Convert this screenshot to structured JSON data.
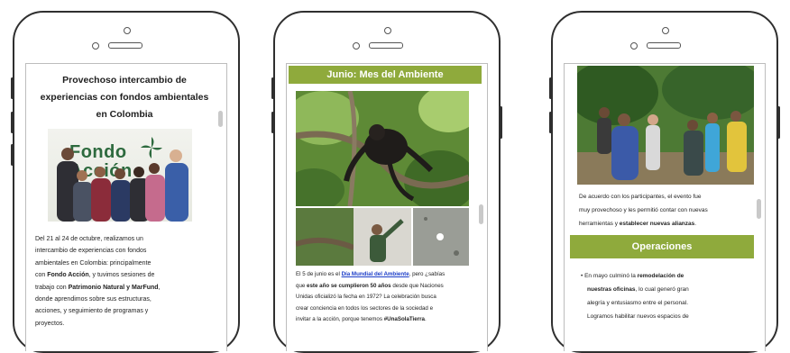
{
  "phone1": {
    "title": [
      "Provechoso intercambio de",
      "experiencias con fondos ambientales",
      "en Colombia"
    ],
    "logo_text": [
      "Fondo",
      "Acción"
    ],
    "body_lines": [
      [
        "Del 21 al 24 de octubre, realizamos un"
      ],
      [
        "intercambio de experiencias con fondos"
      ],
      [
        "ambientales en Colombia: principalmente"
      ],
      [
        "con ",
        "Fondo Acción",
        ", y tuvimos sesiones de"
      ],
      [
        "trabajo con ",
        "Patrimonio Natural y MarFund",
        ","
      ],
      [
        "donde aprendimos sobre sus estructuras,"
      ],
      [
        "acciones, y seguimiento de programas y"
      ],
      [
        "proyectos."
      ]
    ]
  },
  "phone2": {
    "banner": "Junio: Mes del Ambiente",
    "body_lines": [
      [
        "El 5 de junio es el ",
        "Día Mundial del Ambiente",
        ", pero ¿sabías"
      ],
      [
        "que ",
        "este año se cumplieron 50 años",
        " desde que Naciones"
      ],
      [
        "Unidas oficializó la fecha en 1972? La celebración busca"
      ],
      [
        "crear conciencia en todos los sectores de la sociedad e"
      ],
      [
        "invitar a la acción, porque tenemos ",
        "#UnaSolaTierra",
        "."
      ]
    ]
  },
  "phone3": {
    "body_lines": [
      [
        "De acuerdo con los participantes, el evento fue"
      ],
      [
        "muy provechoso y les permitió contar con nuevas"
      ],
      [
        "herramientas y ",
        "establecer nuevas alianzas",
        "."
      ]
    ],
    "banner": "Operaciones",
    "bullet_lines": [
      [
        "En mayo culminó la ",
        "remodelación de"
      ],
      [
        "nuestras oficinas",
        ", lo cual generó gran"
      ],
      [
        "alegría y entusiasmo entre el personal."
      ],
      [
        "Logramos habilitar nuevos espacios de"
      ]
    ]
  },
  "colors": {
    "accent_green": "#8faa3c",
    "link_blue": "#1a3cc8",
    "frame": "#2f2f2f"
  }
}
